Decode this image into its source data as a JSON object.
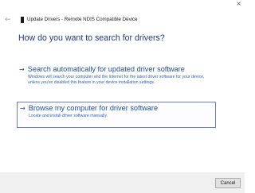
{
  "window": {
    "title": "Update Drivers - Remote NDIS Compatible Device",
    "close_glyph": "×",
    "back_glyph": "←"
  },
  "main": {
    "heading": "How do you want to search for drivers?",
    "options": [
      {
        "arrow": "→",
        "title": "Search automatically for updated driver software",
        "description": "Windows will search your computer and the Internet for the latest driver software for your device, unless you've disabled this feature in your device installation settings."
      },
      {
        "arrow": "→",
        "title": "Browse my computer for driver software",
        "description": "Locate and install driver software manually."
      }
    ]
  },
  "footer": {
    "cancel_label": "Cancel"
  },
  "colors": {
    "heading": "#1c3a8e",
    "link": "#1f4fa3",
    "focus_border": "#6a7fb8"
  },
  "icons": {
    "back": "back-arrow-icon",
    "device": "device-icon",
    "option_arrow": "arrow-right-icon",
    "close": "close-icon"
  }
}
